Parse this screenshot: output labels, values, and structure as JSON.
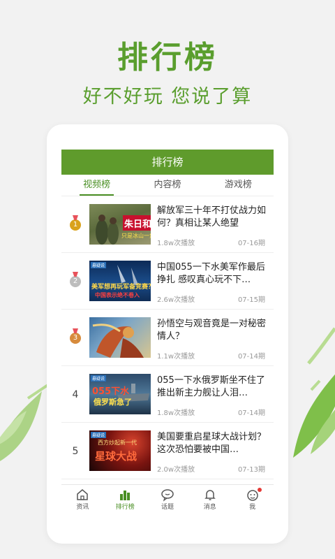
{
  "hero": {
    "title": "排行榜",
    "subtitle": "好不好玩 您说了算"
  },
  "app": {
    "header_title": "排行榜",
    "tabs": [
      {
        "label": "视频榜",
        "active": true
      },
      {
        "label": "内容榜",
        "active": false
      },
      {
        "label": "游戏榜",
        "active": false
      }
    ],
    "items": [
      {
        "rank": "1",
        "medal": "gold",
        "title": "解放军三十年不打仗战力如何？真相让某人绝望",
        "plays": "1.8w次播放",
        "period": "07-16期",
        "thumb_caption": "朱日和",
        "thumb_sub": "只是冰山一角"
      },
      {
        "rank": "2",
        "medal": "silver",
        "title": "中国055一下水美军作最后挣扎 感叹真心玩不下…",
        "plays": "2.6w次播放",
        "period": "07-15期",
        "thumb_caption": "美军想再玩军备竞赛？",
        "thumb_sub": "中国表示绝不卷入"
      },
      {
        "rank": "3",
        "medal": "bronze",
        "title": "孙悟空与观音竟是一对秘密情人？",
        "plays": "1.1w次播放",
        "period": "07-14期",
        "thumb_caption": "",
        "thumb_sub": ""
      },
      {
        "rank": "4",
        "medal": "",
        "title": "055一下水俄罗斯坐不住了 推出新主力舰让人泪…",
        "plays": "1.8w次播放",
        "period": "07-14期",
        "thumb_caption": "055下水",
        "thumb_sub": "俄罗斯急了"
      },
      {
        "rank": "5",
        "medal": "",
        "title": "美国要重启星球大战计划？这次恐怕要被中国…",
        "plays": "2.0w次播放",
        "period": "07-13期",
        "thumb_caption": "星球大战",
        "thumb_sub": "西方炒起新一代"
      }
    ],
    "bottom_nav": [
      {
        "label": "资讯",
        "icon": "home-icon",
        "active": false
      },
      {
        "label": "排行榜",
        "icon": "bar-chart-icon",
        "active": true
      },
      {
        "label": "话题",
        "icon": "chat-bubble-icon",
        "active": false
      },
      {
        "label": "消息",
        "icon": "bell-icon",
        "active": false
      },
      {
        "label": "我",
        "icon": "face-icon",
        "active": false
      }
    ]
  },
  "colors": {
    "brand_green": "#5f9b2c",
    "hero_green": "#5a9e2e",
    "notify_red": "#e53935"
  }
}
